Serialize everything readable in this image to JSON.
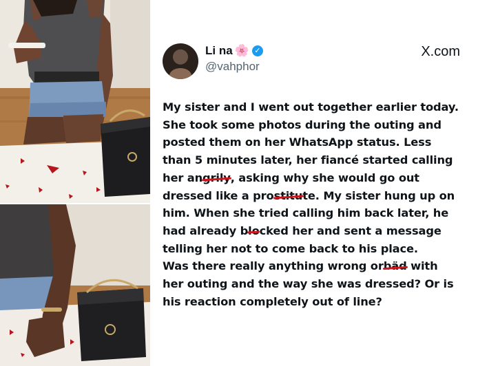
{
  "post": {
    "display_name": "Li na",
    "name_emoji": "🌸",
    "verified_icon": "verified-badge-icon",
    "handle": "@vahphor",
    "site": "X.com",
    "site_logo": "x-logo-icon",
    "brand_color": "#1d9bf0",
    "strike_color": "#d0161d",
    "lines": [
      [
        "My sister and I went out together earlier today."
      ],
      [
        "She took some photos during the outing and"
      ],
      [
        "posted them on her WhatsApp status. Less"
      ],
      [
        "than 5 minutes later, her fiancé started calling"
      ],
      [
        "her an",
        "grily",
        ", asking why she would go out"
      ],
      [
        "dressed like a pro",
        "stitu",
        "te. My sister hung up on"
      ],
      [
        "him. When she tried calling him back later, he"
      ],
      [
        "had already b",
        "lo",
        "cked her and sent a message"
      ],
      [
        "telling her not to come back to his place."
      ],
      [
        "Was there really anything wrong or",
        " bäd",
        " with"
      ],
      [
        "her outing and the way she was dressed? Or is"
      ],
      [
        "his reaction completely out of line?"
      ]
    ]
  }
}
